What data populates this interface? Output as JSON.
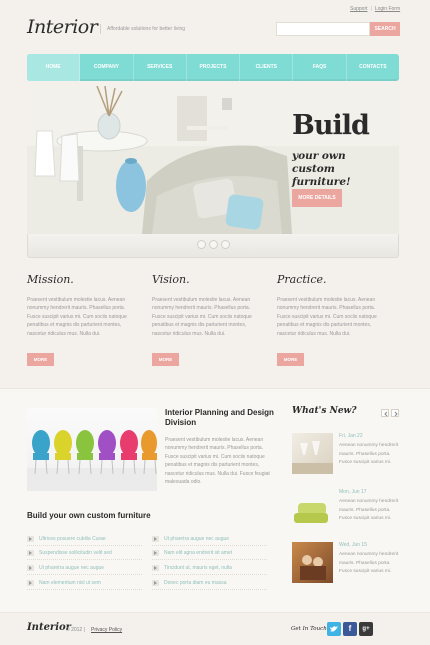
{
  "header": {
    "logo": "Interior",
    "tagline": "Affordable solutions for better living",
    "links": [
      "Support",
      "Login Form"
    ],
    "search_placeholder": "",
    "search_button": "SEARCH"
  },
  "nav": [
    "HOME",
    "COMPANY",
    "SERVICES",
    "PROJECTS",
    "CLIENTS",
    "FAQS",
    "CONTACTS"
  ],
  "banner": {
    "headline": "Build",
    "subheadline": "your own custom furniture!",
    "button": "MORE DETAILS",
    "slide_count": 3
  },
  "columns": [
    {
      "title": "Mission.",
      "text": "Praesent vestibulum molestie lacus. Aenean nonummy hendrerit mauris. Phasellus porta. Fusce suscipit varius mi. Cum sociis natoque penatibus et magnis dis parturient montes, nascetur ridiculus mus. Nulla dui.",
      "button": "MORE"
    },
    {
      "title": "Vision.",
      "text": "Praesent vestibulum molestie lacus. Aenean nonummy hendrerit mauris. Phasellus porta. Fusce suscipit varius mi. Cum sociis natoque penatibus et magnis dis parturient montes, nascetur ridiculus mus. Nulla dui.",
      "button": "MORE"
    },
    {
      "title": "Practice.",
      "text": "Praesent vestibulum molestie lacus. Aenean nonummy hendrerit mauris. Phasellus porta. Fusce suscipit varius mi. Cum sociis natoque penatibus et magnis dis parturient montes, nascetur ridiculus mus. Nulla dui.",
      "button": "MORE"
    }
  ],
  "interior": {
    "title": "Interior Planning and Design Division",
    "text": "Praesent vestibulum molestie lacus. Aenean nonummy hendrerit mauris. Phasellus porta. Fusce suscipit varius mi. Cum sociis natoque penatibus et magnis dis parturient montes, nascetur ridiculus mus. Nulla dui. Fusce feugiat malesuada odio."
  },
  "build": {
    "title": "Build your own custom furniture",
    "list_left": [
      "Ultrices posuere cubilia Curae",
      "Suspendisse sollicitudin velit sed",
      "Ut pharetra augue nec augue",
      "Nam elementum nisl ut sem"
    ],
    "list_right": [
      "Ut pharetra augue nec augue",
      "Nam elit agna endrerit sit amet",
      "Tincidunt ut, mauris eget, nulla",
      "Donec porta diam eu massa"
    ]
  },
  "news": {
    "title": "What's New?",
    "items": [
      {
        "date": "Fri, Jan 22",
        "text": "Aenean nonummy hendrerit mauris. Phasellus porta. Fusce suscipit varius mi."
      },
      {
        "date": "Mon, Jun 17",
        "text": "Aenean nonummy hendrerit mauris. Phasellus porta. Fusce suscipit varius mi."
      },
      {
        "date": "Wed, Jun 15",
        "text": "Aenean nonummy hendrerit mauris. Phasellus porta. Fusce suscipit varius mi."
      }
    ]
  },
  "footer": {
    "logo": "Interior",
    "copyright": "© 2012 |",
    "privacy": "Privacy Policy",
    "get_in_touch": "Get In Touch:",
    "social": [
      "twitter",
      "facebook",
      "google-plus"
    ]
  },
  "colors": {
    "accent_teal": "#7fdcd4",
    "accent_pink": "#eba6a0",
    "background": "#f4f1ec"
  }
}
